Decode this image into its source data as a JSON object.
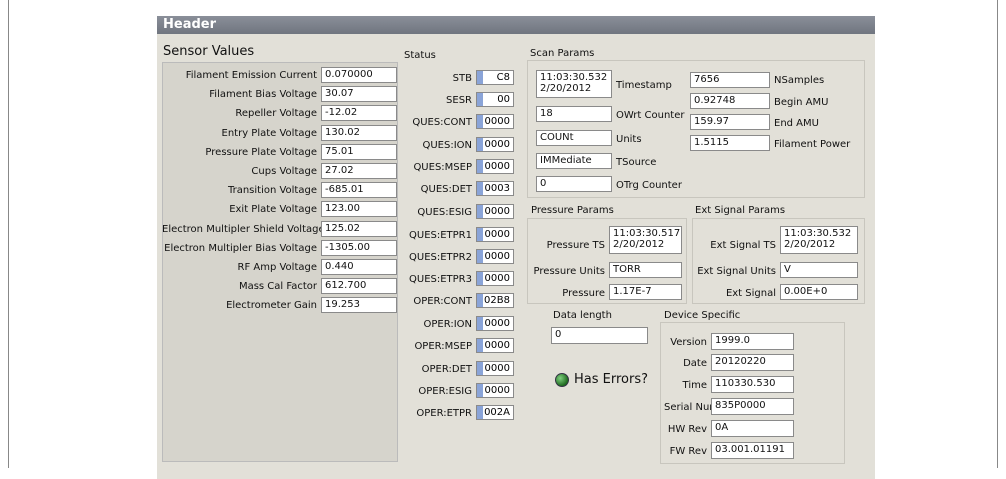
{
  "header": {
    "title": "Header"
  },
  "sensor": {
    "title": "Sensor Values",
    "rows": [
      {
        "label": "Filament Emission Current",
        "value": "0.070000"
      },
      {
        "label": "Filament Bias Voltage",
        "value": "30.07"
      },
      {
        "label": "Repeller Voltage",
        "value": "-12.02"
      },
      {
        "label": "Entry Plate Voltage",
        "value": "130.02"
      },
      {
        "label": "Pressure Plate Voltage",
        "value": "75.01"
      },
      {
        "label": "Cups Voltage",
        "value": "27.02"
      },
      {
        "label": "Transition Voltage",
        "value": "-685.01"
      },
      {
        "label": "Exit Plate Voltage",
        "value": "123.00"
      },
      {
        "label": "Electron Multipler Shield Voltage",
        "value": "125.02"
      },
      {
        "label": "Electron Multipler Bias Voltage",
        "value": "-1305.00"
      },
      {
        "label": "RF Amp Voltage",
        "value": "0.440"
      },
      {
        "label": "Mass Cal Factor",
        "value": "612.700"
      },
      {
        "label": "Electrometer Gain",
        "value": "19.253"
      }
    ]
  },
  "status": {
    "title": "Status",
    "rows": [
      {
        "label": "STB",
        "value": "C8"
      },
      {
        "label": "SESR",
        "value": "00"
      },
      {
        "label": "QUES:CONT",
        "value": "0000"
      },
      {
        "label": "QUES:ION",
        "value": "0000"
      },
      {
        "label": "QUES:MSEP",
        "value": "0000"
      },
      {
        "label": "QUES:DET",
        "value": "0003"
      },
      {
        "label": "QUES:ESIG",
        "value": "0000"
      },
      {
        "label": "QUES:ETPR1",
        "value": "0000"
      },
      {
        "label": "QUES:ETPR2",
        "value": "0000"
      },
      {
        "label": "QUES:ETPR3",
        "value": "0000"
      },
      {
        "label": "OPER:CONT",
        "value": "02B8"
      },
      {
        "label": "OPER:ION",
        "value": "0000"
      },
      {
        "label": "OPER:MSEP",
        "value": "0000"
      },
      {
        "label": "OPER:DET",
        "value": "0000"
      },
      {
        "label": "OPER:ESIG",
        "value": "0000"
      },
      {
        "label": "OPER:ETPR",
        "value": "002A"
      }
    ]
  },
  "scan": {
    "title": "Scan Params",
    "timestamp_value": "11:03:30.532 2/20/2012",
    "timestamp_label": "Timestamp",
    "owrt_value": "18",
    "owrt_label": "OWrt Counter",
    "units_value": "COUNt",
    "units_label": "Units",
    "tsource_value": "IMMediate",
    "tsource_label": "TSource",
    "otrg_value": "0",
    "otrg_label": "OTrg Counter",
    "nsamples_value": "7656",
    "nsamples_label": "NSamples",
    "begin_amu_value": "0.92748",
    "begin_amu_label": "Begin AMU",
    "end_amu_value": "159.97",
    "end_amu_label": "End AMU",
    "fil_power_value": "1.5115",
    "fil_power_label": "Filament Power"
  },
  "pressure": {
    "title": "Pressure Params",
    "ts_label": "Pressure TS",
    "ts_value": "11:03:30.517 2/20/2012",
    "units_label": "Pressure Units",
    "units_value": "TORR",
    "pressure_label": "Pressure",
    "pressure_value": "1.17E-7"
  },
  "ext": {
    "title": "Ext Signal Params",
    "ts_label": "Ext Signal TS",
    "ts_value": "11:03:30.532 2/20/2012",
    "units_label": "Ext Signal Units",
    "units_value": "V",
    "signal_label": "Ext Signal",
    "signal_value": "0.00E+0"
  },
  "datalength": {
    "title": "Data length",
    "value": "0"
  },
  "errors": {
    "label": "Has Errors?",
    "led_color": "#2f8f2f"
  },
  "device": {
    "title": "Device Specific",
    "rows": [
      {
        "label": "Version",
        "value": "1999.0"
      },
      {
        "label": "Date",
        "value": "20120220"
      },
      {
        "label": "Time",
        "value": "110330.530"
      },
      {
        "label": "Serial Number",
        "value": "835P0000"
      },
      {
        "label": "HW Rev",
        "value": "0A"
      },
      {
        "label": "FW Rev",
        "value": "03.001.01191"
      }
    ]
  }
}
